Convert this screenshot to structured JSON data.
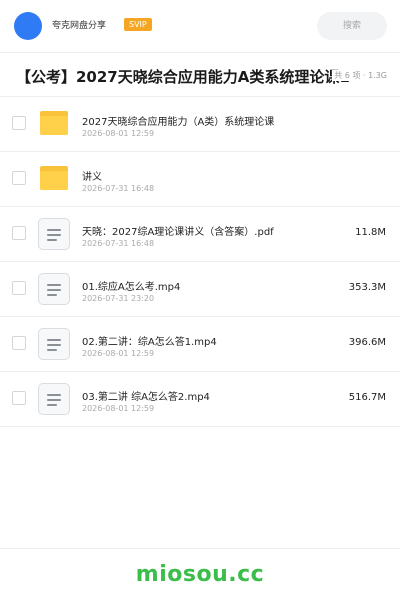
{
  "header": {
    "share_name": "夸克网盘分享",
    "badge": "SVIP",
    "search_placeholder": "搜索"
  },
  "folder": {
    "title": "【公考】2027天晓综合应用能力A类系统理论课1",
    "summary": "共 6 项 · 1.3G"
  },
  "files": [
    {
      "type": "folder",
      "name": "2027天晓综合应用能力（A类）系统理论课",
      "date": "2026-08-01 12:59",
      "size": ""
    },
    {
      "type": "folder",
      "name": "讲义",
      "date": "2026-07-31 16:48",
      "size": ""
    },
    {
      "type": "file",
      "name": "天晓：2027综A理论课讲义（含答案）.pdf",
      "date": "2026-07-31 16:48",
      "size": "11.8M"
    },
    {
      "type": "file",
      "name": "01.综应A怎么考.mp4",
      "date": "2026-07-31 23:20",
      "size": "353.3M"
    },
    {
      "type": "file",
      "name": "02.第二讲：综A怎么答1.mp4",
      "date": "2026-08-01 12:59",
      "size": "396.6M"
    },
    {
      "type": "file",
      "name": "03.第二讲 综A怎么答2.mp4",
      "date": "2026-08-01 12:59",
      "size": "516.7M"
    }
  ],
  "footer": {
    "logo_text": "miosou.cc"
  },
  "colors": {
    "avatar": "#2f7bf5",
    "badge": "#f5a623",
    "folder": "#ffd04a",
    "logo": "#3bbd4a"
  },
  "icons": {
    "folder": "folder-icon",
    "file": "document-icon"
  }
}
